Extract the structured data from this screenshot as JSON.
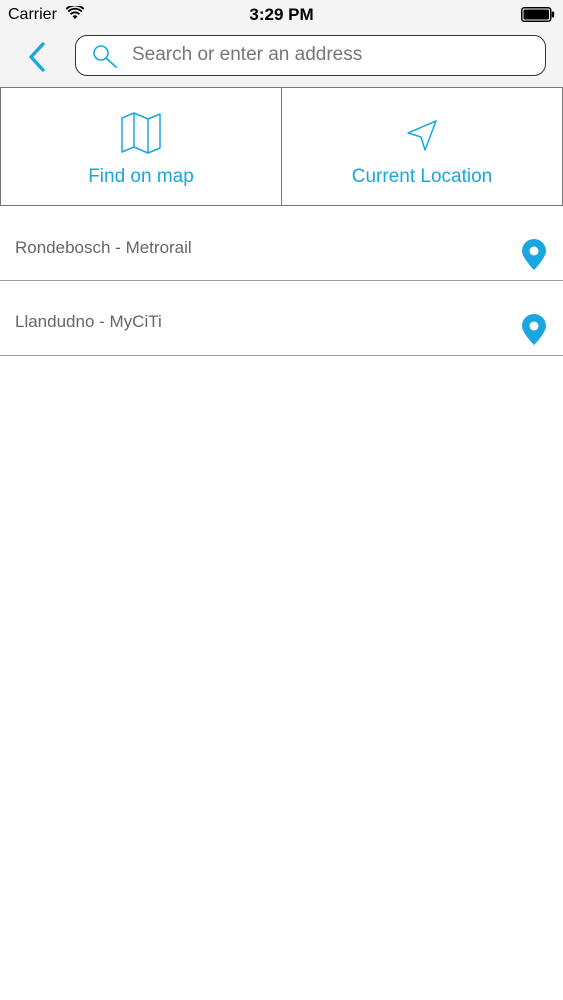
{
  "status_bar": {
    "carrier": "Carrier",
    "time": "3:29 PM",
    "wifi_icon": "wifi-icon",
    "battery_icon": "battery-icon"
  },
  "header": {
    "back_icon": "chevron-left-icon",
    "search": {
      "placeholder": "Search or enter an address",
      "value": "",
      "icon": "search-icon"
    }
  },
  "actions": [
    {
      "label": "Find on map",
      "icon": "map-icon"
    },
    {
      "label": "Current Location",
      "icon": "location-arrow-icon"
    }
  ],
  "list": {
    "items": [
      {
        "label": "Rondebosch - Metrorail",
        "icon": "map-pin-icon"
      },
      {
        "label": "Llandudno - MyCiTi",
        "icon": "map-pin-icon"
      }
    ]
  },
  "colors": {
    "accent": "#1aa6df",
    "header_bg": "#f4f4f4",
    "text_secondary": "#666666"
  }
}
